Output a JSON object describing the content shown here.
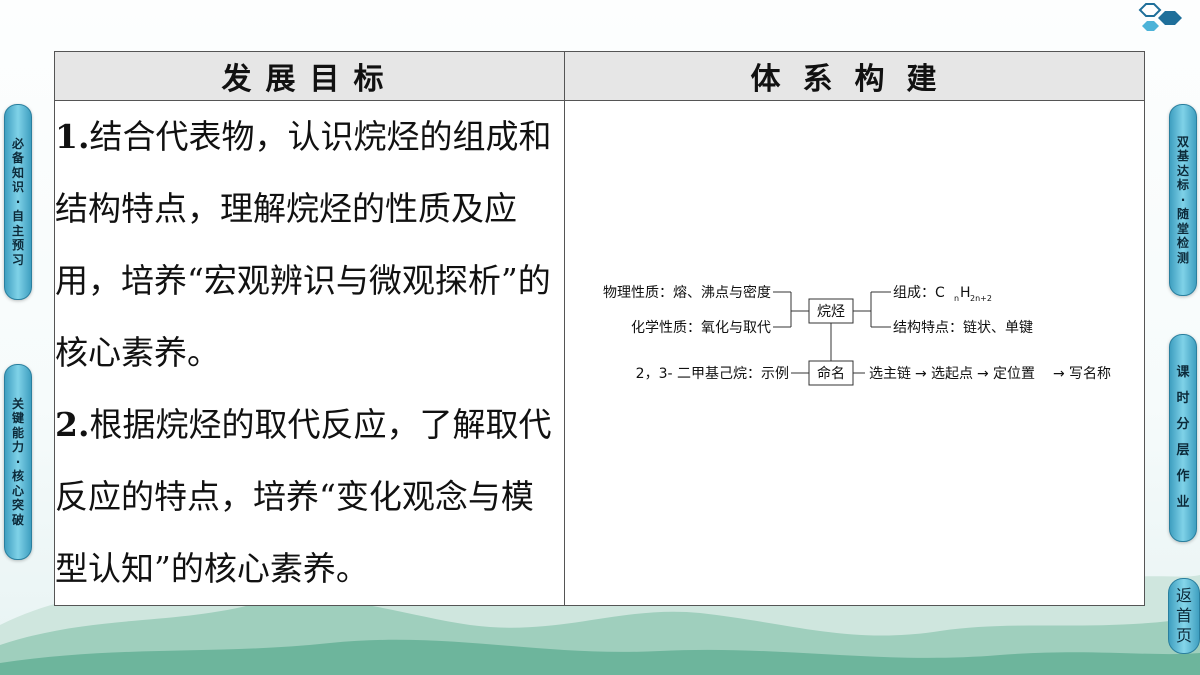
{
  "header": {
    "col1": "发展目标",
    "col2": "体系构建"
  },
  "goals": [
    {
      "num": "1.",
      "text": "结合代表物，认识烷烃的组成和结构特点，理解烷烃的性质及应用，培养“宏观辨识与微观探析”的核心素养。"
    },
    {
      "num": "2.",
      "text": "根据烷烃的取代反应，了解取代反应的特点，培养“变化观念与模型认知”的核心素养。"
    }
  ],
  "diagram": {
    "center": "烷烃",
    "left_top": "物理性质：熔、沸点与密度",
    "left_bottom": "化学性质：氧化与取代",
    "right_top": "组成：C",
    "formula_sub_n": "n",
    "formula_h": "H",
    "formula_sub_2n2": "2n+2",
    "right_bottom": "结构特点：链状、单键",
    "naming": "命名",
    "example": "2，3- 二甲基己烷：示例",
    "steps": [
      "选主链",
      "选起点",
      "定位置",
      "写名称"
    ],
    "arrow": "→"
  },
  "nav": {
    "left_tabs": [
      "必备知识·自主预习",
      "关键能力·核心突破"
    ],
    "right_tabs": [
      "双基达标·随堂检测",
      "课时分层作业"
    ],
    "return": "返首页"
  },
  "colors": {
    "tab": "#5bb8d6",
    "header_bg": "#e6e6e6",
    "logo": "#1f6f9a"
  }
}
